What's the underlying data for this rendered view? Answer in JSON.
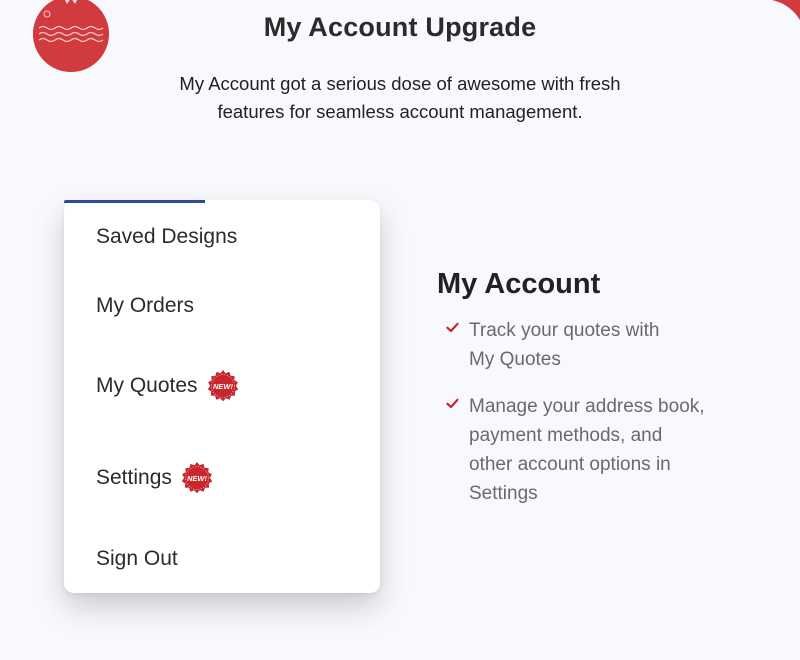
{
  "header": {
    "title": "My Account Upgrade",
    "subtitle_line1": "My Account got a serious dose of awesome with fresh",
    "subtitle_line2": "features for seamless account management."
  },
  "menu": {
    "items": [
      {
        "label": "Saved Designs",
        "is_new": false
      },
      {
        "label": "My Orders",
        "is_new": false
      },
      {
        "label": "My Quotes",
        "is_new": true
      },
      {
        "label": "Settings",
        "is_new": true
      },
      {
        "label": "Sign Out",
        "is_new": false
      }
    ],
    "new_badge_text": "NEW!"
  },
  "feature": {
    "title": "My Account",
    "bullets": [
      {
        "line1": "Track your quotes with",
        "line2": "My Quotes"
      },
      {
        "line1": "Manage your address book,",
        "line2": "payment methods, and",
        "line3": "other account options in",
        "line4": "Settings"
      }
    ]
  },
  "colors": {
    "accent_blue": "#2b4a9b",
    "badge_red": "#c8262c",
    "check_red": "#c8262c",
    "page_bg": "#f8f9fc"
  }
}
